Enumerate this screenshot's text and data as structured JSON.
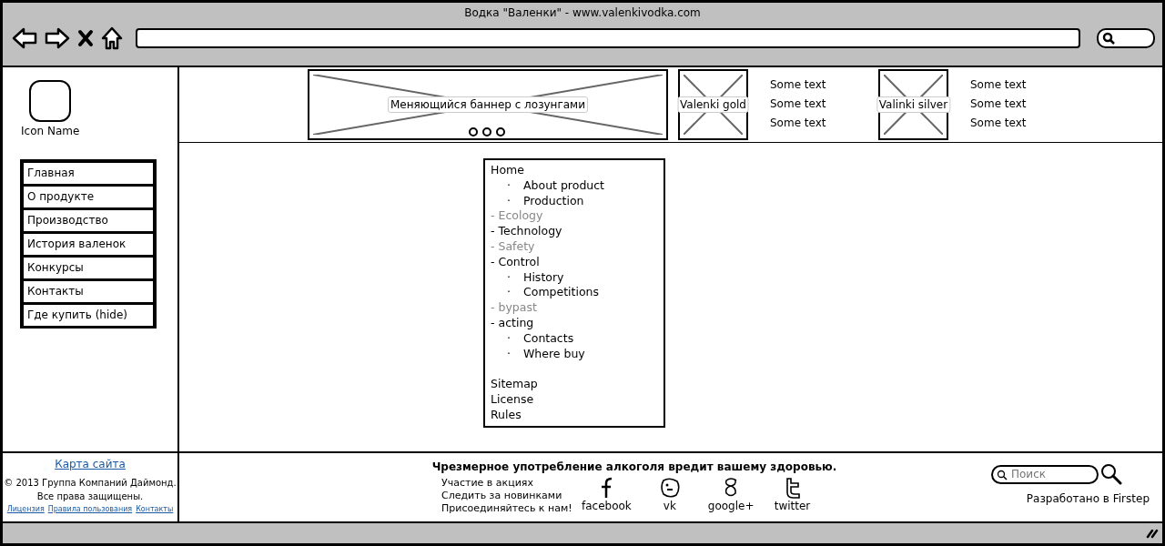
{
  "window": {
    "title": "Водка \"Валенки\" - www.valenkivodka.com"
  },
  "logo": {
    "label": "Icon Name"
  },
  "nav": [
    {
      "label": "Главная"
    },
    {
      "label": "О продукте"
    },
    {
      "label": "Производство"
    },
    {
      "label": "История валенок"
    },
    {
      "label": "Конкурсы"
    },
    {
      "label": "Контакты"
    },
    {
      "label": "Где купить (hide)"
    }
  ],
  "banner": {
    "label": "Меняющийся баннер с лозунгами"
  },
  "products": [
    {
      "label": "Valenki gold",
      "lines": [
        "Some text",
        "Some text",
        "Some text"
      ]
    },
    {
      "label": "Valinki silver",
      "lines": [
        "Some text",
        "Some text",
        "Some text"
      ]
    }
  ],
  "sitemap": {
    "items": [
      {
        "label": "Home",
        "disabled": false,
        "children": [
          {
            "marker": "·",
            "label": "About product"
          },
          {
            "marker": "·",
            "label": "Production"
          }
        ]
      },
      {
        "label": "- Ecology",
        "disabled": true
      },
      {
        "label": "- Technology",
        "disabled": false
      },
      {
        "label": "- Safety",
        "disabled": true
      },
      {
        "label": "- Control",
        "disabled": false,
        "children": [
          {
            "marker": "·",
            "label": "History"
          },
          {
            "marker": "·",
            "label": "Competitions"
          }
        ]
      },
      {
        "label": "- bypast",
        "disabled": true
      },
      {
        "label": "- acting",
        "disabled": false,
        "children": [
          {
            "marker": "·",
            "label": "Contacts"
          },
          {
            "marker": "·",
            "label": "Where buy"
          }
        ]
      }
    ],
    "extra_links": [
      "Sitemap",
      "License",
      "Rules"
    ]
  },
  "footer": {
    "sitemap_link": "Карта сайта",
    "copyright": [
      "© 2013 Группа Компаний Даймонд.",
      "Все права защищены."
    ],
    "links": [
      "Лицензия",
      "Правила пользования",
      "Контакты"
    ],
    "warning": "Чрезмерное употребление алкоголя вредит вашему здоровью.",
    "promo_lines": [
      "Участие в акциях",
      "Следить за новинками",
      "Присоединяйтесь к нам!"
    ],
    "social": [
      {
        "kind": "facebook",
        "label": "facebook"
      },
      {
        "kind": "vk",
        "label": "vk"
      },
      {
        "kind": "google",
        "label": "google+"
      },
      {
        "kind": "twitter",
        "label": "twitter"
      }
    ],
    "search": {
      "placeholder": "Поиск"
    },
    "credit": "Разработано в Firstep"
  }
}
